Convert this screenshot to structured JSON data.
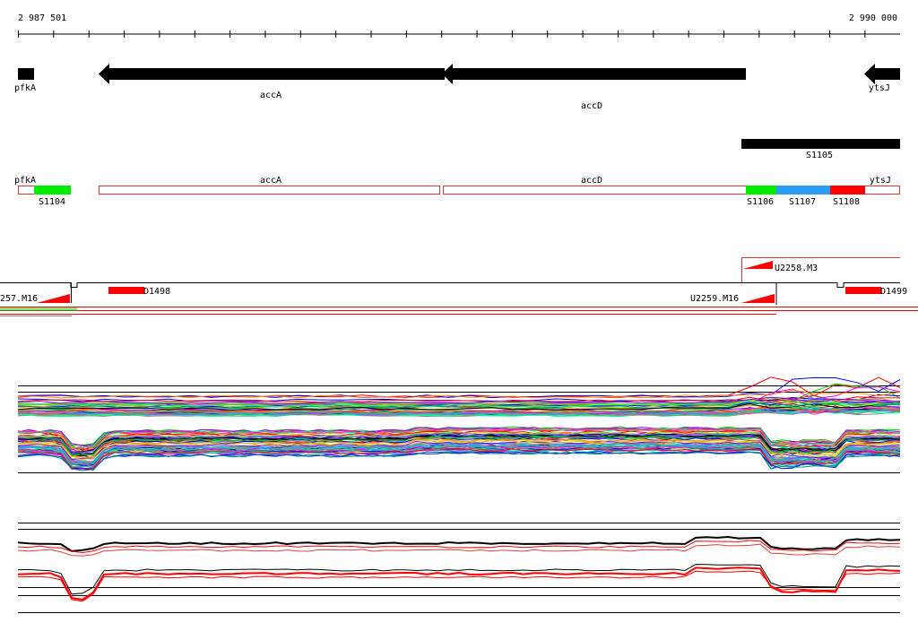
{
  "ruler": {
    "start_label": "2 987 501",
    "end_label": "2 990 000"
  },
  "genes": [
    {
      "name": "pfkA",
      "strand": "+"
    },
    {
      "name": "accA",
      "strand": "-"
    },
    {
      "name": "accD",
      "strand": "-"
    },
    {
      "name": "ytsJ",
      "strand": "-"
    }
  ],
  "upper_segment": {
    "label": "S1105"
  },
  "annotation_track": {
    "gene_labels": [
      "pfkA",
      "accA",
      "accD",
      "ytsJ"
    ],
    "segments": [
      {
        "label": "S1104",
        "color": "#00ee00"
      },
      {
        "label": "S1106",
        "color": "#00ee00"
      },
      {
        "label": "S1107",
        "color": "#2a9df4"
      },
      {
        "label": "S1108",
        "color": "#ff0000"
      }
    ]
  },
  "features": {
    "upper_label": "U2258.M3",
    "labels": [
      "257.M16",
      "D1498",
      "U2259.M16",
      "D1499"
    ]
  },
  "colors": {
    "gene": "#000000",
    "annotation_outline": "#e03030",
    "feature_red": "#ff0000",
    "green": "#00ee00",
    "blue": "#2a9df4"
  }
}
